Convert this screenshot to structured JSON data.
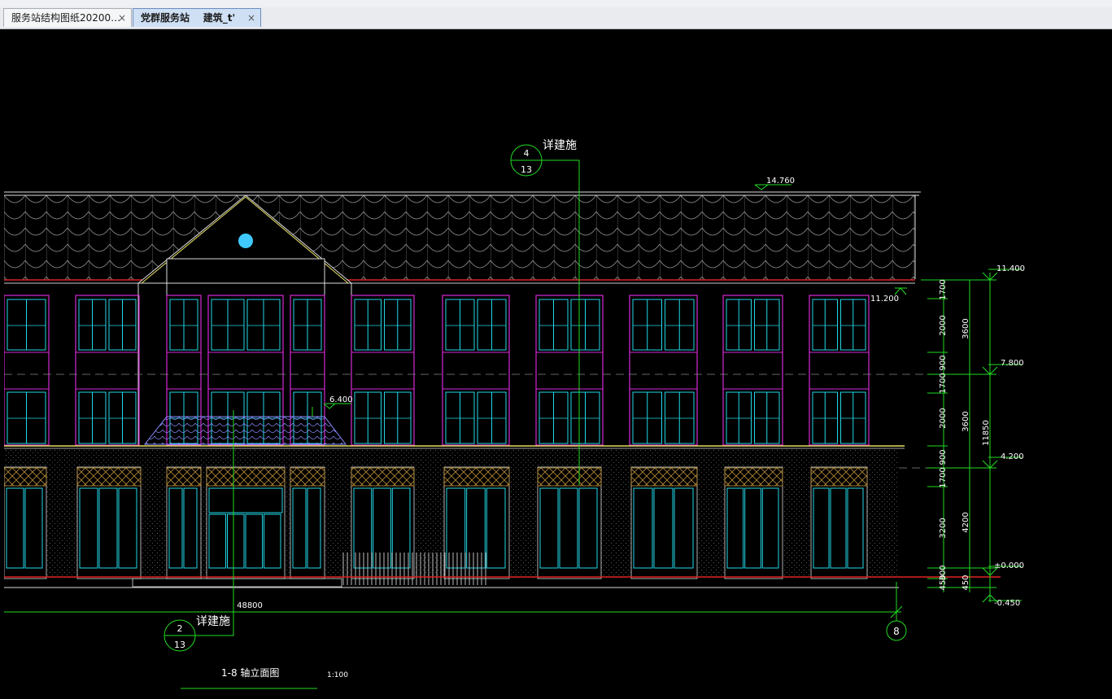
{
  "tabs": [
    {
      "label": "服务站结构图纸20200…",
      "close": "×"
    },
    {
      "label": "党群服务站    建筑_t'",
      "close": "×"
    }
  ],
  "drawing": {
    "callout_top": {
      "label": "详建施",
      "num": "4",
      "sheet": "13"
    },
    "callout_bottom": {
      "label": "详建施",
      "num": "2",
      "sheet": "13"
    },
    "elev_roof": "14.760",
    "elev_eave_right": "11.400",
    "elev_eave_left": "11.200",
    "elev_third": "7.800",
    "elev_second": "4.200",
    "elev_canopy": "6.400",
    "elev_ground": "±0.000",
    "elev_base": "-0.450",
    "dims_left": [
      "1700",
      "2000",
      "900",
      "1700",
      "2000",
      "900",
      "1700",
      "3200",
      "300",
      "450"
    ],
    "dims_mid": [
      "3600",
      "3600",
      "4200",
      "450"
    ],
    "dim_total_height": "11850",
    "dim_total_width": "48800",
    "axis_label": "8",
    "title": "1-8 轴立面图",
    "scale": "1:100"
  }
}
